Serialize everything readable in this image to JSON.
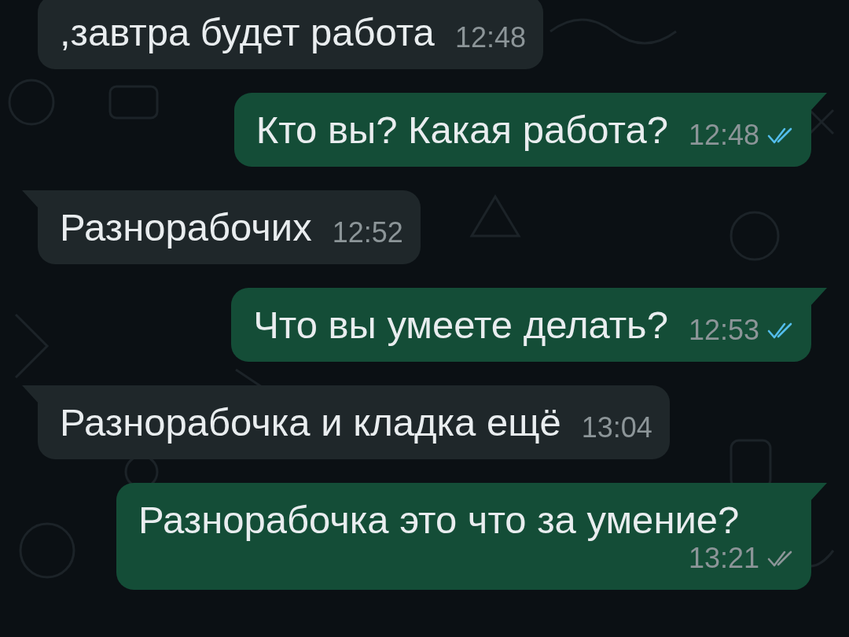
{
  "messages": [
    {
      "kind": "incoming",
      "text": ",завтра будет работа",
      "time": "12:48",
      "tail": false
    },
    {
      "kind": "outgoing",
      "text": "Кто вы? Какая работа?",
      "time": "12:48",
      "read": true,
      "tail": true
    },
    {
      "kind": "incoming",
      "text": "Разнорабочих",
      "time": "12:52",
      "tail": true
    },
    {
      "kind": "outgoing",
      "text": "Что вы умеете делать?",
      "time": "12:53",
      "read": true,
      "tail": true
    },
    {
      "kind": "incoming",
      "text": "Разнорабочка и кладка ещё",
      "time": "13:04",
      "tail": true
    },
    {
      "kind": "outgoing",
      "text": "Разнорабочка это что за умение?",
      "time": "13:21",
      "read": false,
      "tail": true
    }
  ]
}
